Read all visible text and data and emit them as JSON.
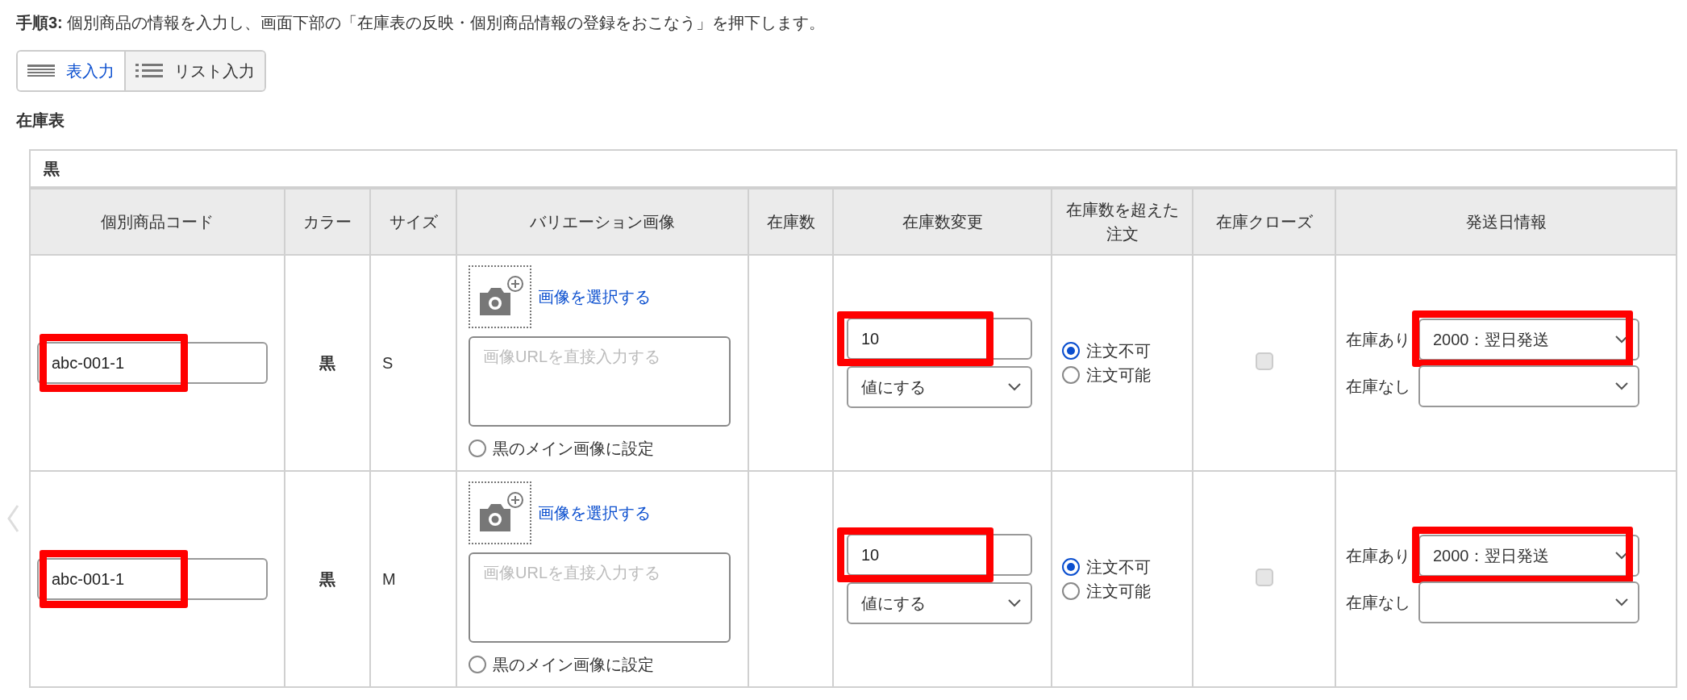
{
  "instruction": {
    "step": "手順3:",
    "text": "個別商品の情報を入力し、画面下部の「在庫表の反映・個別商品情報の登録をおこなう」を押下します。"
  },
  "view_toggle": [
    {
      "label": "表入力",
      "kind": "table",
      "selected": true
    },
    {
      "label": "リスト入力",
      "kind": "list",
      "selected": false
    }
  ],
  "section_title": "在庫表",
  "stock_table": {
    "group": "黒",
    "columns": [
      "個別商品コード",
      "カラー",
      "サイズ",
      "バリエーション画像",
      "在庫数",
      "在庫数変更",
      "在庫数を超えた注文",
      "在庫クローズ",
      "発送日情報"
    ],
    "rows": [
      {
        "code": {
          "value": "abc-001-1",
          "highlighted": true
        },
        "color_name": "黒",
        "size": "S",
        "image": {
          "select_link": "画像を選択する",
          "url_placeholder": "画像URLを直接入力する",
          "main_image": {
            "label": "黒のメイン画像に設定",
            "selected": false
          }
        },
        "stock_change": {
          "value": "10",
          "highlighted": true,
          "mode": "値にする"
        },
        "over_order": [
          {
            "label": "注文不可",
            "selected": true
          },
          {
            "label": "注文可能",
            "selected": false
          }
        ],
        "stock_close": {
          "checked": false,
          "disabled": true
        },
        "shipping": [
          {
            "label": "在庫あり",
            "value": "2000：翌日発送",
            "highlighted": true
          },
          {
            "label": "在庫なし",
            "highlighted": false
          }
        ]
      },
      {
        "code": {
          "value": "abc-001-1",
          "highlighted": true
        },
        "color_name": "黒",
        "size": "M",
        "image": {
          "select_link": "画像を選択する",
          "url_placeholder": "画像URLを直接入力する",
          "main_image": {
            "label": "黒のメイン画像に設定",
            "selected": false
          }
        },
        "stock_change": {
          "value": "10",
          "highlighted": true,
          "mode": "値にする"
        },
        "over_order": [
          {
            "label": "注文不可",
            "selected": true
          },
          {
            "label": "注文可能",
            "selected": false
          }
        ],
        "stock_close": {
          "checked": false,
          "disabled": true
        },
        "shipping": [
          {
            "label": "在庫あり",
            "value": "2000：翌日発送",
            "highlighted": true
          },
          {
            "label": "在庫なし",
            "highlighted": false
          }
        ]
      }
    ]
  }
}
